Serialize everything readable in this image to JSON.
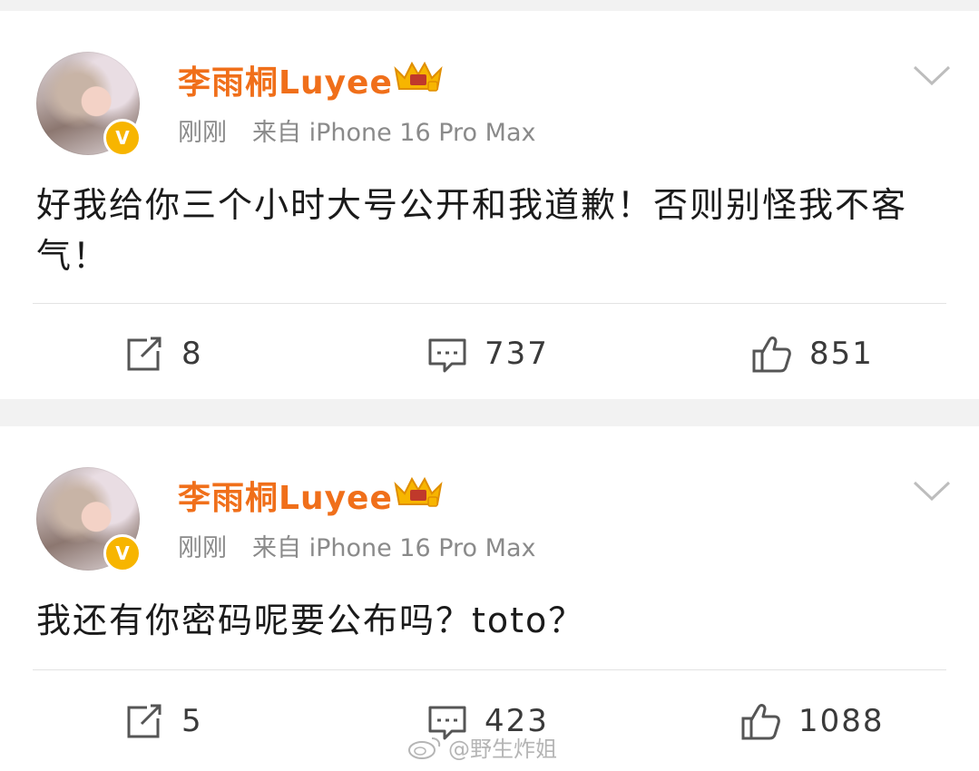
{
  "posts": [
    {
      "username": "李雨桐Luyee",
      "time": "刚刚",
      "source": "来自 iPhone 16 Pro Max",
      "text": "好我给你三个小时大号公开和我道歉！否则别怪我不客气！",
      "reposts": "8",
      "comments": "737",
      "likes": "851"
    },
    {
      "username": "李雨桐Luyee",
      "time": "刚刚",
      "source": "来自 iPhone 16 Pro Max",
      "text": "我还有你密码呢要公布吗？toto？",
      "reposts": "5",
      "comments": "423",
      "likes": "1088"
    }
  ],
  "watermark": "@野生炸姐",
  "icons": {
    "verified": "verified-v-badge-icon",
    "vip": "crown-icon",
    "menu": "chevron-down-icon",
    "repost": "repost-icon",
    "comment": "comment-icon",
    "like": "thumbs-up-icon",
    "watermark": "weibo-logo-icon"
  },
  "colors": {
    "username": "#f06f1a",
    "verified_badge": "#f7b500",
    "meta": "#8a8a8a",
    "background": "#f2f2f2"
  }
}
